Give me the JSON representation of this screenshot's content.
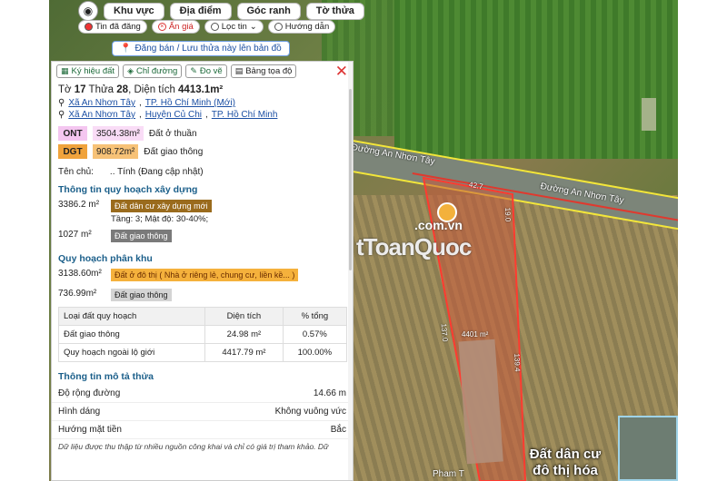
{
  "toolbar": {
    "buttons": [
      "Khu vực",
      "Địa điểm",
      "Góc ranh",
      "Tờ thửa"
    ],
    "filters": [
      "Tin đã đăng",
      "Ẩn giá",
      "Lọc tin",
      "Hướng dẫn"
    ],
    "post_label": "Đăng bán / Lưu thửa này lên bản đồ"
  },
  "panel": {
    "tabs": [
      "Ký hiệu đất",
      "Chỉ đường",
      "Đo vẽ",
      "Bảng tọa độ"
    ],
    "title_pre": "Tờ ",
    "sheet": "17",
    "title_mid": " Thửa ",
    "parcel": "28",
    "title_area_label": ", Diện tích ",
    "area": "4413.1m²",
    "address_new": [
      "Xã An Nhơn Tây",
      "TP. Hồ Chí Minh (Mới)"
    ],
    "address_old": [
      "Xã An Nhơn Tây",
      "Huyện Củ Chi",
      "TP. Hồ Chí Minh"
    ],
    "land_types": [
      {
        "code": "ONT",
        "area": "3504.38m²",
        "desc": "Đất ở thuần",
        "bg": "#f4c6f0",
        "area_bg": "#f9dcf6"
      },
      {
        "code": "DGT",
        "area": "908.72m²",
        "desc": "Đất giao thông",
        "bg": "#f0a33c",
        "area_bg": "#f7c277"
      }
    ],
    "owner_label": "Tên chủ:",
    "owner_value": ".. Tính (Đang cập nhật)",
    "section_construction": "Thông tin quy hoạch xây dựng",
    "construction": [
      {
        "area": "3386.2 m²",
        "label": "Đất dân cư xây dựng mới",
        "color": "#9a6b1d",
        "sub": "Tầng: 3; Mật độ: 30-40%;"
      },
      {
        "area": "1027 m²",
        "label": "Đất giao thông",
        "color": "#7a7a7a",
        "sub": ""
      }
    ],
    "section_zone": "Quy hoạch phân khu",
    "zone": [
      {
        "area": "3138.60m²",
        "label": "Đất ở đô thị ( Nhà ở riêng lẻ, chung cư, liền kề... )",
        "color": "#f5b13c",
        "text": "#6b2d00"
      },
      {
        "area": "736.99m²",
        "label": "Đất giao thông",
        "color": "#d4d4d4",
        "text": "#222"
      }
    ],
    "table_headers": [
      "Loại đất quy hoạch",
      "Diện tích",
      "% tổng"
    ],
    "table_rows": [
      [
        "Đất giao thông",
        "24.98 m²",
        "0.57%"
      ],
      [
        "Quy hoạch ngoài lộ giới",
        "4417.79 m²",
        "100.00%"
      ]
    ],
    "section_desc": "Thông tin mô tả thửa",
    "desc_rows": [
      [
        "Độ rộng đường",
        "14.66 m"
      ],
      [
        "Hình dáng",
        "Không vuông vức"
      ],
      [
        "Hướng mặt tiền",
        "Bắc"
      ]
    ],
    "note": "Dữ liệu được thu thập từ nhiều nguồn công khai và chỉ có giá trị tham khảo. Dữ"
  },
  "map": {
    "road1": "Đường An Nhơn Tây",
    "road2": "Đường An Nhơn Tây",
    "dim_top": "42.7",
    "dim_right_top": "19.0",
    "dim_left": "137.0",
    "dim_right": "139.4",
    "parcel_area": "4401 m²",
    "watermark": "tToanQuoc",
    "watermark_small": ".com.vn",
    "zone_label_line1": "Đất dân cư",
    "zone_label_line2": "đô thị hóa",
    "road_bottom": "Pham T"
  }
}
